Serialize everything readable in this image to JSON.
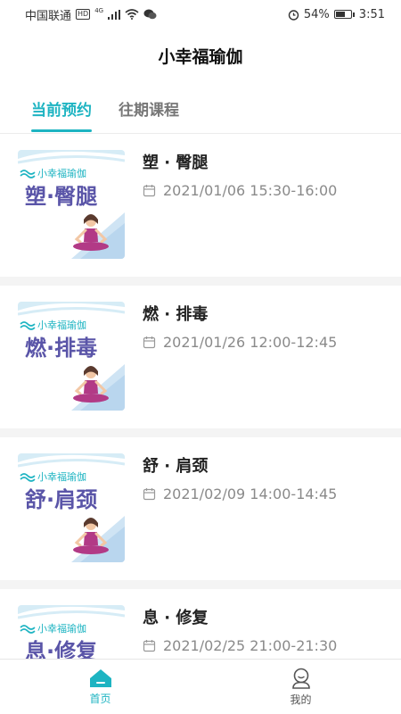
{
  "status_bar": {
    "carrier": "中国联通",
    "hd_badge": "HD",
    "network": "4G",
    "battery_percent": "54%",
    "time": "3:51"
  },
  "header": {
    "title": "小幸福瑜伽"
  },
  "tabs": [
    {
      "label": "当前预约",
      "active": true
    },
    {
      "label": "往期课程",
      "active": false
    }
  ],
  "thumbnail": {
    "brand_text": "小幸福瑜伽"
  },
  "courses": [
    {
      "title": "塑 · 臀腿",
      "thumb_text": "塑·臀腿",
      "time": "2021/01/06 15:30-16:00"
    },
    {
      "title": "燃 · 排毒",
      "thumb_text": "燃·排毒",
      "time": "2021/01/26 12:00-12:45"
    },
    {
      "title": "舒 · 肩颈",
      "thumb_text": "舒·肩颈",
      "time": "2021/02/09 14:00-14:45"
    },
    {
      "title": "息 · 修复",
      "thumb_text": "息·修复",
      "time": "2021/02/25 21:00-21:30"
    }
  ],
  "bottom_nav": [
    {
      "label": "首页",
      "icon": "home-icon",
      "active": true
    },
    {
      "label": "我的",
      "icon": "profile-icon",
      "active": false
    }
  ],
  "colors": {
    "accent": "#1eb4c2",
    "thumb_text": "#5a55a8",
    "thumb_wave": "#d6ecf6",
    "figure_clothes": "#b23a86",
    "skin": "#f2c7a5"
  }
}
